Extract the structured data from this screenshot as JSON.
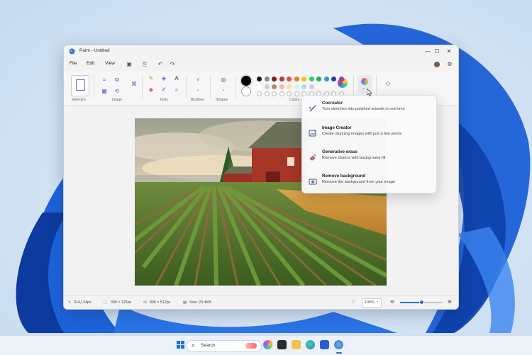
{
  "window": {
    "title": "Paint - Untitled",
    "controls": {
      "minimize": "—",
      "maximize": "☐",
      "close": "✕"
    }
  },
  "menu": {
    "file": "File",
    "edit": "Edit",
    "view": "View"
  },
  "ribbon": {
    "groups": {
      "selection": "Selection",
      "image": "Image",
      "tools": "Tools",
      "brushes": "Brushes",
      "shapes": "Shapes",
      "colors": "Colors"
    },
    "palette_top": [
      "#1a1a1a",
      "#8a8a8a",
      "#7a1f1f",
      "#c0392b",
      "#e74c3c",
      "#e67e22",
      "#f1c40f",
      "#2ecc71",
      "#27ae60",
      "#3498db",
      "#2c3e9e",
      "#8e44ad"
    ],
    "palette_bottom": [
      "#ffffff",
      "#d0d0d0",
      "#b5876b",
      "#f5b7c7",
      "#f9e79f",
      "#d5f5e3",
      "#aed6f1",
      "#d6c6f0"
    ],
    "primary_color": "#000000",
    "secondary_color": "#ffffff"
  },
  "cocreator_menu": {
    "items": [
      {
        "title": "Cocreator",
        "desc": "Turn sketches into polished artwork in real time",
        "icon": "brush-sparkle-icon"
      },
      {
        "title": "Image Creator",
        "desc": "Create stunning images with just a few words",
        "icon": "image-sparkle-icon"
      },
      {
        "title": "Generative erase",
        "desc": "Remove objects with background fill",
        "icon": "eraser-sparkle-icon"
      },
      {
        "title": "Remove background",
        "desc": "Remove the background from your image",
        "icon": "remove-background-icon"
      }
    ]
  },
  "status": {
    "cursor": "314,124px",
    "selection_size": "300 × 125px",
    "canvas_size": "800 × 512px",
    "file_size": "Size: 20.4KB",
    "zoom": "100%",
    "zoom_level": 0.5
  },
  "taskbar": {
    "search_label": "Search"
  }
}
